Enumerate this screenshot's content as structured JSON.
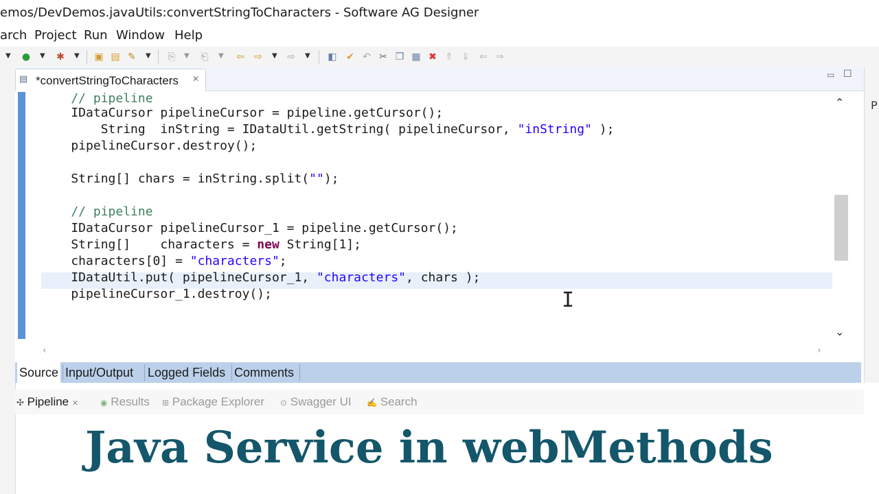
{
  "window": {
    "title": "emos/DevDemos.javaUtils:convertStringToCharacters - Software AG Designer"
  },
  "menu": {
    "items": [
      "arch",
      "Project",
      "Run",
      "Window",
      "Help"
    ]
  },
  "editor": {
    "tab_label": "*convertStringToCharacters",
    "code_lines": [
      {
        "parts": [
          {
            "t": "    // pipeline",
            "c": "cm"
          }
        ]
      },
      {
        "parts": [
          {
            "t": "    IDataCursor pipelineCursor = pipeline.getCursor();",
            "c": ""
          }
        ]
      },
      {
        "parts": [
          {
            "t": "        String  inString = IDataUtil.getString( pipelineCursor, ",
            "c": ""
          },
          {
            "t": "\"inString\"",
            "c": "st"
          },
          {
            "t": " );",
            "c": ""
          }
        ]
      },
      {
        "parts": [
          {
            "t": "    pipelineCursor.destroy();",
            "c": ""
          }
        ]
      },
      {
        "parts": [
          {
            "t": "",
            "c": ""
          }
        ]
      },
      {
        "parts": [
          {
            "t": "    String[] chars = inString.split(",
            "c": ""
          },
          {
            "t": "\"\"",
            "c": "st"
          },
          {
            "t": ");",
            "c": ""
          }
        ]
      },
      {
        "parts": [
          {
            "t": "",
            "c": ""
          }
        ]
      },
      {
        "parts": [
          {
            "t": "    // pipeline",
            "c": "cm"
          }
        ]
      },
      {
        "parts": [
          {
            "t": "    IDataCursor pipelineCursor_1 = pipeline.getCursor();",
            "c": ""
          }
        ]
      },
      {
        "parts": [
          {
            "t": "    String[]    characters = ",
            "c": ""
          },
          {
            "t": "new",
            "c": "kw"
          },
          {
            "t": " String[1];",
            "c": ""
          }
        ]
      },
      {
        "parts": [
          {
            "t": "    characters[0] = ",
            "c": ""
          },
          {
            "t": "\"characters\"",
            "c": "st"
          },
          {
            "t": ";",
            "c": ""
          }
        ]
      },
      {
        "parts": [
          {
            "t": "    IDataUtil.put( pipelineCursor_1, ",
            "c": ""
          },
          {
            "t": "\"characters\"",
            "c": "st"
          },
          {
            "t": ", chars );",
            "c": ""
          }
        ]
      },
      {
        "parts": [
          {
            "t": "    pipelineCursor_1.destroy();",
            "c": ""
          }
        ]
      },
      {
        "parts": [
          {
            "t": "",
            "c": ""
          }
        ]
      },
      {
        "parts": [
          {
            "t": "",
            "c": ""
          }
        ]
      },
      {
        "parts": [
          {
            "t": "}",
            "c": ""
          }
        ]
      }
    ],
    "bottom_tabs": [
      "Source",
      "Input/Output",
      "Logged Fields",
      "Comments"
    ]
  },
  "views": {
    "tabs": [
      "Pipeline",
      "Results",
      "Package Explorer",
      "Swagger UI",
      "Search"
    ]
  },
  "overlay": {
    "title": "Java Service in webMethods"
  },
  "side_panel": {
    "letter": "P"
  },
  "colors": {
    "comment": "#3f7f5f",
    "string": "#2a00ff",
    "keyword": "#7f0055",
    "overlay_title": "#14566a",
    "gutter": "#5b93d6"
  },
  "icons": [
    "file-java-icon",
    "close-icon",
    "minimize-icon",
    "maximize-icon",
    "run-icon",
    "debug-icon",
    "text-cursor-icon"
  ]
}
